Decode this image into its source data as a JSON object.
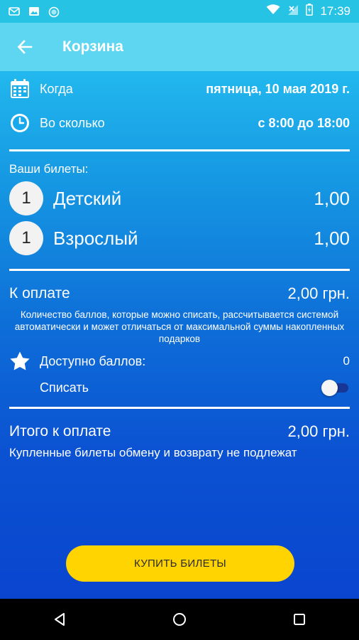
{
  "status_bar": {
    "time": "17:39",
    "icons": [
      "mail-icon",
      "image-icon",
      "circle-icon",
      "wifi-icon",
      "signal-icon",
      "battery-icon"
    ]
  },
  "app_bar": {
    "title": "Корзина",
    "back_icon": "arrow-back-icon"
  },
  "booking": {
    "date_label": "Когда",
    "date_value": "пятница, 10 мая 2019 г.",
    "time_label": "Во сколько",
    "time_value": "с 8:00 до 18:00"
  },
  "tickets": {
    "title": "Ваши билеты:",
    "items": [
      {
        "qty": "1",
        "name": "Детский",
        "price": "1,00"
      },
      {
        "qty": "1",
        "name": "Взрослый",
        "price": "1,00"
      }
    ]
  },
  "payment": {
    "label": "К оплате",
    "amount": "2,00 грн.",
    "notice": "Количество баллов, которые можно списать, рассчитывается системой автоматически и может отличаться от максимальной суммы накопленных подарков",
    "points_label": "Доступно баллов:",
    "points_value": "0",
    "writeoff_label": "Списать",
    "writeoff_enabled": false
  },
  "total": {
    "label": "Итого к оплате",
    "amount": "2,00 грн.",
    "disclaimer": "Купленные билеты обмену и возврату не подлежат"
  },
  "buy_button": {
    "label": "КУПИТЬ БИЛЕТЫ"
  },
  "colors": {
    "status_bar": "#27c3e5",
    "app_bar": "#5ed6f1",
    "button": "#ffd400",
    "background_top": "#22b8ee",
    "background_bottom": "#0a45cf"
  },
  "nav": {
    "back": "nav-back-icon",
    "home": "nav-home-icon",
    "recents": "nav-recents-icon"
  }
}
